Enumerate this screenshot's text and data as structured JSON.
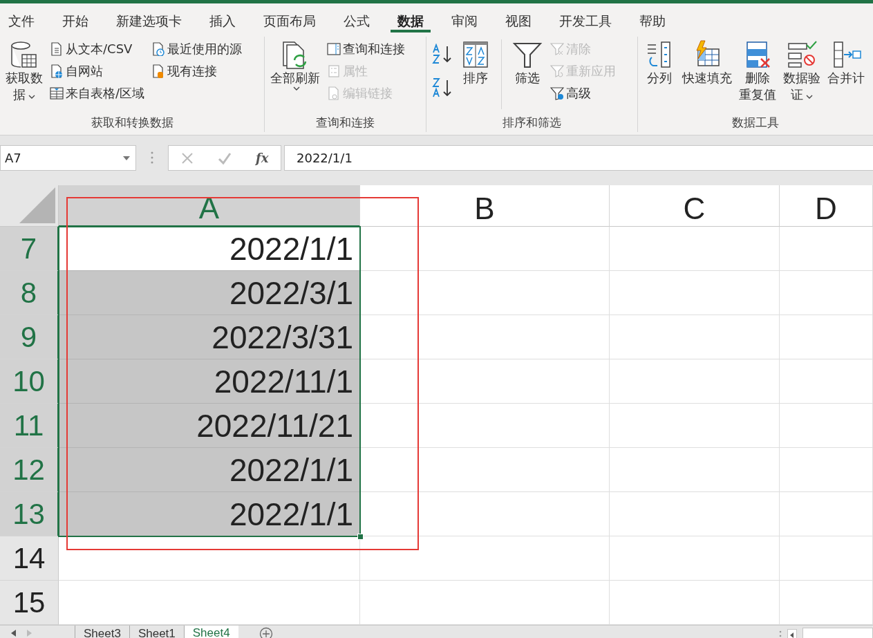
{
  "ribbon_tabs": [
    {
      "label": "文件",
      "selected": false
    },
    {
      "label": "开始",
      "selected": false
    },
    {
      "label": "新建选项卡",
      "selected": false
    },
    {
      "label": "插入",
      "selected": false
    },
    {
      "label": "页面布局",
      "selected": false
    },
    {
      "label": "公式",
      "selected": false
    },
    {
      "label": "数据",
      "selected": true
    },
    {
      "label": "审阅",
      "selected": false
    },
    {
      "label": "视图",
      "selected": false
    },
    {
      "label": "开发工具",
      "selected": false
    },
    {
      "label": "帮助",
      "selected": false
    }
  ],
  "ribbon_groups": [
    {
      "title": "获取和转换数据",
      "items": [
        {
          "kind": "large",
          "lines": [
            "获取数",
            "据"
          ],
          "caret": true
        },
        {
          "kind": "stack",
          "buttons": [
            {
              "label": "从文本/CSV",
              "disabled": false
            },
            {
              "label": "自网站",
              "disabled": false
            },
            {
              "label": "来自表格/区域",
              "disabled": false
            }
          ]
        },
        {
          "kind": "stack",
          "buttons": [
            {
              "label": "最近使用的源",
              "disabled": false
            },
            {
              "label": "现有连接",
              "disabled": false
            }
          ]
        }
      ]
    },
    {
      "title": "查询和连接",
      "items": [
        {
          "kind": "large",
          "lines": [
            "全部刷新"
          ],
          "caret": true
        },
        {
          "kind": "stack",
          "buttons": [
            {
              "label": "查询和连接",
              "disabled": false
            },
            {
              "label": "属性",
              "disabled": true
            },
            {
              "label": "编辑链接",
              "disabled": true
            }
          ]
        }
      ]
    },
    {
      "title": "排序和筛选",
      "items": [
        {
          "kind": "icons",
          "buttons": [
            {
              "disabled": false
            },
            {
              "disabled": false
            }
          ]
        },
        {
          "kind": "large",
          "lines": [
            "排序"
          ]
        },
        {
          "kind": "separator"
        },
        {
          "kind": "large",
          "lines": [
            "筛选"
          ]
        },
        {
          "kind": "stack",
          "buttons": [
            {
              "label": "清除",
              "disabled": true
            },
            {
              "label": "重新应用",
              "disabled": true
            },
            {
              "label": "高级",
              "disabled": false
            }
          ]
        }
      ]
    },
    {
      "title": "数据工具",
      "items": [
        {
          "kind": "large",
          "lines": [
            "分列"
          ]
        },
        {
          "kind": "large",
          "lines": [
            "快速填充"
          ]
        },
        {
          "kind": "large",
          "lines": [
            "删除",
            "重复值"
          ]
        },
        {
          "kind": "large",
          "lines": [
            "数据验",
            "证"
          ],
          "caret": true
        },
        {
          "kind": "large",
          "lines": [
            "合并计"
          ]
        }
      ]
    }
  ],
  "formula_bar": {
    "name_box": "A7",
    "function_label": "fx",
    "value": "2022/1/1"
  },
  "columns": [
    {
      "label": "A",
      "selected": true
    },
    {
      "label": "B",
      "selected": false
    },
    {
      "label": "C",
      "selected": false
    },
    {
      "label": "D",
      "selected": false
    }
  ],
  "rows": [
    {
      "header": "7",
      "selected": true,
      "active": true,
      "value": "2022/1/1"
    },
    {
      "header": "8",
      "selected": true,
      "active": false,
      "value": "2022/3/1"
    },
    {
      "header": "9",
      "selected": true,
      "active": false,
      "value": "2022/3/31"
    },
    {
      "header": "10",
      "selected": true,
      "active": false,
      "value": "2022/11/1"
    },
    {
      "header": "11",
      "selected": true,
      "active": false,
      "value": "2022/11/21"
    },
    {
      "header": "12",
      "selected": true,
      "active": false,
      "value": "2022/1/1"
    },
    {
      "header": "13",
      "selected": true,
      "active": false,
      "value": "2022/1/1"
    },
    {
      "header": "14",
      "selected": false,
      "active": false
    },
    {
      "header": "15",
      "selected": false,
      "active": false
    }
  ],
  "sheet_tabs": [
    {
      "label": "Sheet3",
      "selected": false
    },
    {
      "label": "Sheet1",
      "selected": false
    },
    {
      "label": "Sheet4",
      "selected": true
    }
  ]
}
